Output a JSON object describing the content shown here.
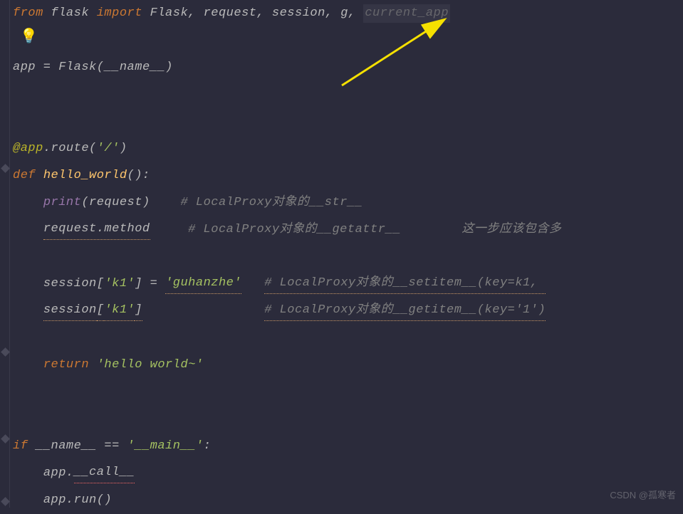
{
  "code": {
    "line1": {
      "from": "from",
      "module": "flask",
      "import": "import",
      "items": "Flask, request, session, g, ",
      "unused": "current_app"
    },
    "line3": {
      "var": "app = ",
      "cls": "Flask",
      "paren_open": "(",
      "builtin": "__name__",
      "paren_close": ")"
    },
    "line6": {
      "decorator": "@app",
      "dot": ".",
      "route": "route",
      "paren_open": "(",
      "path": "'/'",
      "paren_close": ")"
    },
    "line7": {
      "def": "def ",
      "name": "hello_world",
      "sig": "():"
    },
    "line8": {
      "indent": "    ",
      "print": "print",
      "paren_open": "(",
      "arg": "request",
      "paren_close": ")",
      "spaces": "    ",
      "comment": "# LocalProxy对象的__str__"
    },
    "line9": {
      "indent": "    ",
      "expr": "request.method",
      "spaces": "     ",
      "comment": "# LocalProxy对象的__getattr__        这一步应该包含多"
    },
    "line11": {
      "indent": "    ",
      "left_name": "session",
      "left_bracket": "[",
      "left_key": "'k1'",
      "left_close": "]",
      "eq": " = ",
      "right": "'guhanzhe'",
      "spaces": "   ",
      "comment": "# LocalProxy对象的__setitem__(key=k1, "
    },
    "line12": {
      "indent": "    ",
      "expr_name": "session",
      "bracket": "[",
      "key": "'k1'",
      "close": "]",
      "spaces": "                ",
      "comment": "# LocalProxy对象的__getitem__(key='1')"
    },
    "line14": {
      "indent": "    ",
      "return": "return ",
      "val": "'hello world~'"
    },
    "line17": {
      "if": "if ",
      "name": "__name__",
      "eq": " == ",
      "main": "'__main__'",
      "colon": ":"
    },
    "line18": {
      "indent": "    ",
      "app": "app.",
      "call": "__call__"
    },
    "line19": {
      "indent": "    ",
      "app": "app.",
      "run": "run",
      "parens": "()"
    }
  },
  "bulb": "💡",
  "watermark": "CSDN @孤寒者"
}
